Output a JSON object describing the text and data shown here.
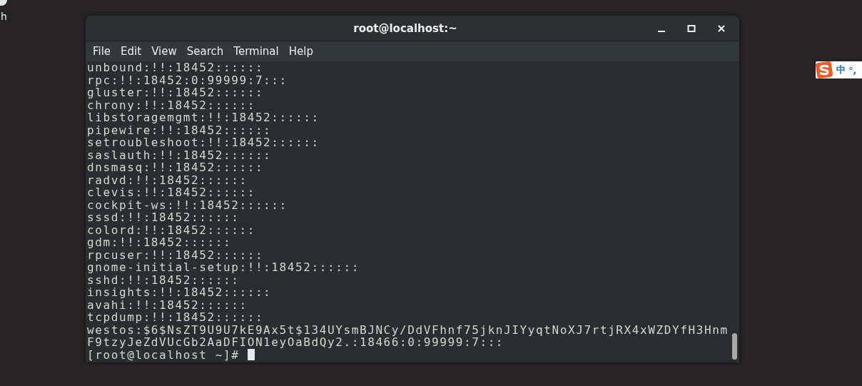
{
  "desktop": {
    "icon_label": "h"
  },
  "window": {
    "title": "root@localhost:~"
  },
  "menu": [
    "File",
    "Edit",
    "View",
    "Search",
    "Terminal",
    "Help"
  ],
  "terminal": {
    "lines": [
      "unbound:!!:18452::::::",
      "rpc:!!:18452:0:99999:7:::",
      "gluster:!!:18452::::::",
      "chrony:!!:18452::::::",
      "libstoragemgmt:!!:18452::::::",
      "pipewire:!!:18452::::::",
      "setroubleshoot:!!:18452::::::",
      "saslauth:!!:18452::::::",
      "dnsmasq:!!:18452::::::",
      "radvd:!!:18452::::::",
      "clevis:!!:18452::::::",
      "cockpit-ws:!!:18452::::::",
      "sssd:!!:18452::::::",
      "colord:!!:18452::::::",
      "gdm:!!:18452::::::",
      "rpcuser:!!:18452::::::",
      "gnome-initial-setup:!!:18452::::::",
      "sshd:!!:18452::::::",
      "insights:!!:18452::::::",
      "avahi:!!:18452::::::",
      "tcpdump:!!:18452::::::",
      "westos:$6$NsZT9U9U7kE9Ax5t$134UYsmBJNCy/DdVFhnf75jknJIYyqtNoXJ7rtjRX4xWZDYfH3Hnm",
      "F9tzyJeZdVUcGb2AaDFION1eyOaBdQy2.:18466:0:99999:7:::"
    ],
    "prompt": "[root@localhost ~]# "
  },
  "ime": {
    "mode": "中",
    "punct": "°,"
  }
}
